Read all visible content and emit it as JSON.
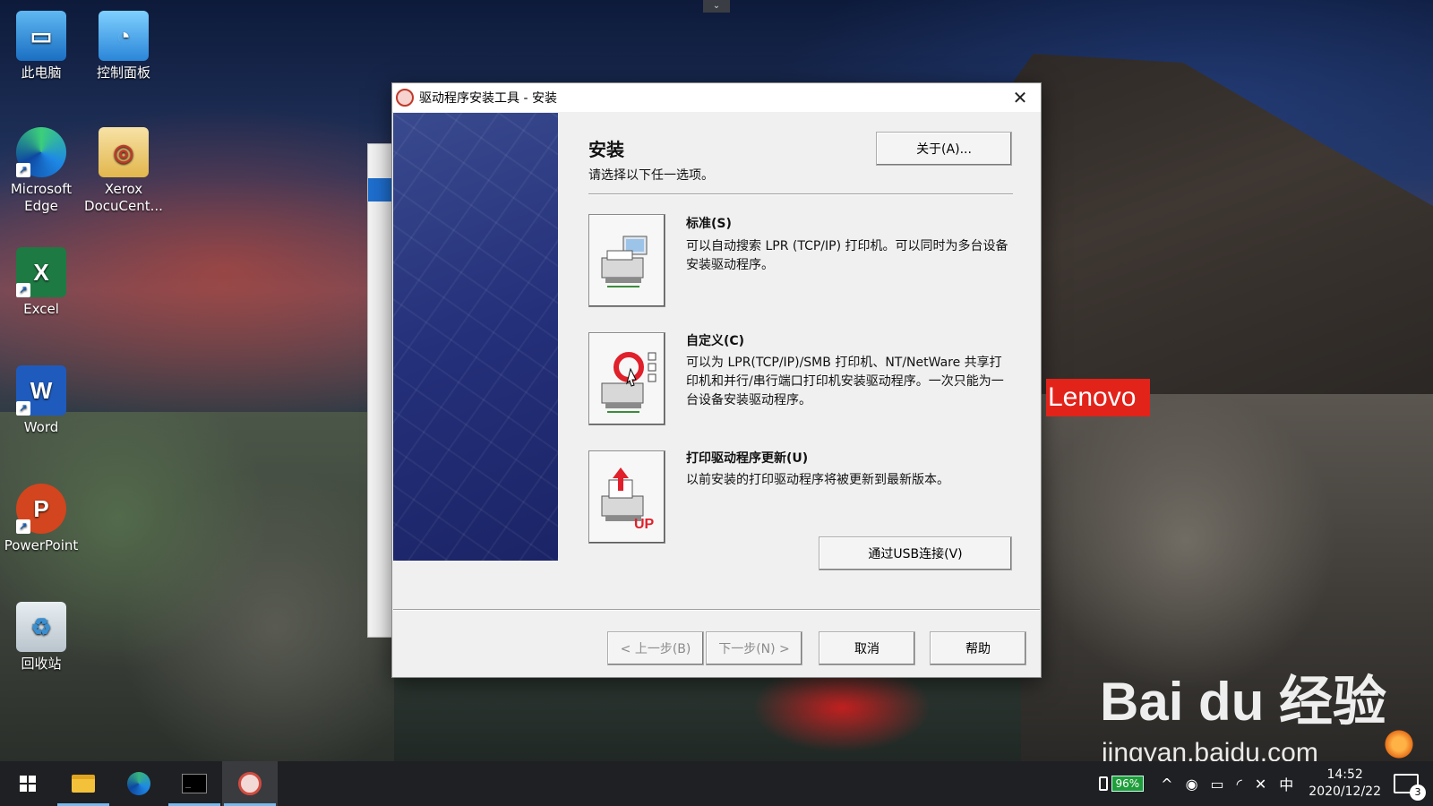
{
  "desktop": {
    "icons": [
      {
        "label": "此电脑"
      },
      {
        "label": "控制面板"
      },
      {
        "label": "Microsoft Edge"
      },
      {
        "label": "Xerox DocuCent..."
      },
      {
        "label": "Excel"
      },
      {
        "label": "Word"
      },
      {
        "label": "PowerPoint"
      },
      {
        "label": "回收站"
      }
    ],
    "lenovo_badge": "Lenovo",
    "watermark": {
      "logo": "Bai du 经验",
      "url": "jingyan.baidu.com"
    }
  },
  "dialog": {
    "title": "驱动程序安装工具 - 安装",
    "heading": "安装",
    "subtitle": "请选择以下任一选项。",
    "about_button": "关于(A)...",
    "options": [
      {
        "title": "标准(S)",
        "description": "可以自动搜索 LPR (TCP/IP) 打印机。可以同时为多台设备安装驱动程序。",
        "icon": "printer-computer-icon"
      },
      {
        "title": "自定义(C)",
        "description": "可以为 LPR(TCP/IP)/SMB 打印机、NT/NetWare 共享打印机和并行/串行端口打印机安装驱动程序。一次只能为一台设备安装驱动程序。",
        "icon": "printer-custom-icon"
      },
      {
        "title": "打印驱动程序更新(U)",
        "description": "以前安装的打印驱动程序将被更新到最新版本。",
        "icon": "printer-update-icon",
        "icon_text": "UP"
      }
    ],
    "usb_button": "通过USB连接(V)",
    "footer": {
      "back": "< 上一步(B)",
      "next": "下一步(N) >",
      "cancel": "取消",
      "help": "帮助"
    },
    "close_glyph": "✕"
  },
  "taskbar": {
    "battery_percent": "96%",
    "ime": "中",
    "time": "14:52",
    "date": "2020/12/22",
    "notification_count": "3"
  },
  "colors": {
    "accent": "#1e6fd0",
    "lenovo_red": "#e2231a",
    "battery_green": "#1f9d3a"
  }
}
